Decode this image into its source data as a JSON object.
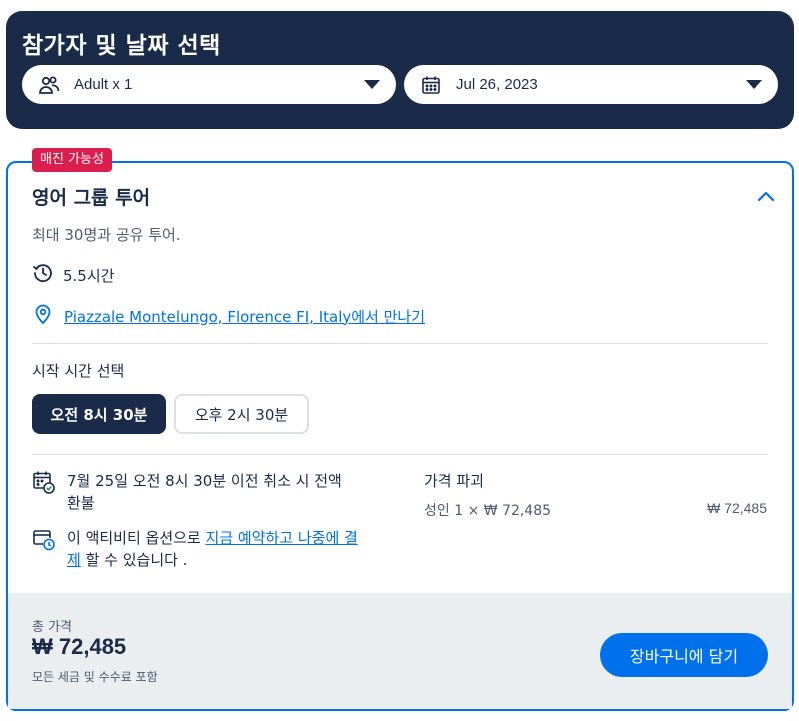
{
  "header": {
    "title": "참가자 및 날짜 선택",
    "travelers_label": "Adult x 1",
    "date_label": "Jul 26, 2023"
  },
  "option": {
    "badge": "매진 가능성",
    "title": "영어 그룹 투어",
    "description": "최대 30명과 공유 투어.",
    "duration": "5.5시간",
    "meeting_point_link": "Piazzale Montelungo, Florence FI, Italy",
    "meeting_point_suffix": "에서 만나기",
    "start_time_label": "시작 시간 선택",
    "times": [
      "오전 8시 30분",
      "오후 2시 30분"
    ],
    "cancellation": "7월 25일 오전 8시 30분 이전 취소 시 전액 환불",
    "reserve_prefix": "이 액티비티 옵션으로 ",
    "reserve_link": "지금 예약하고 나중에 결제",
    "reserve_suffix": " 할 수 있습니다 ."
  },
  "price": {
    "heading": "가격 파괴",
    "line": "성인 1 × ₩ 72,485",
    "line_amount": "₩ 72,485",
    "total_label": "총 가격",
    "total_value": "₩ 72,485",
    "total_note": "모든 세금 및 수수료 포함",
    "cart_button": "장바구니에 담기"
  },
  "icons": {
    "travelers": "people-icon",
    "date": "calendar-icon",
    "collapse": "chevron-up-icon",
    "duration": "clock-history-icon",
    "location": "location-pin-icon",
    "cancellation": "calendar-check-icon",
    "reserve": "calendar-clock-icon"
  },
  "colors": {
    "navy": "#1a2b49",
    "blue": "#0071eb",
    "badge_red": "#dc1e4e",
    "footer_gray": "#ebeef1"
  }
}
